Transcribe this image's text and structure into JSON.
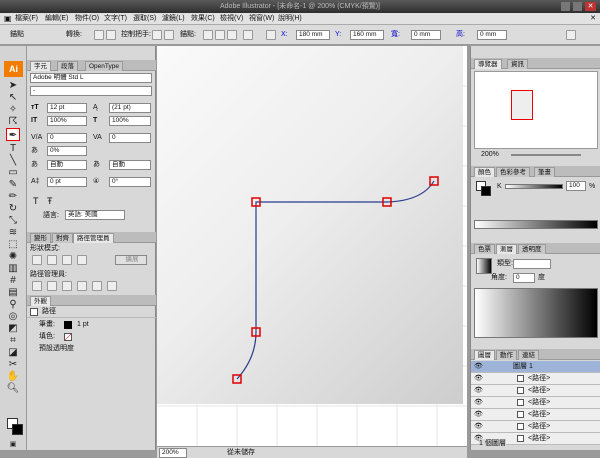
{
  "window": {
    "title": "Adobe Illustrator - [未命名-1 @ 200% (CMYK/預覽)]",
    "ai_logo": "Ai"
  },
  "menu": [
    "檔案(F)",
    "編輯(E)",
    "物件(O)",
    "文字(T)",
    "選取(S)",
    "濾鏡(L)",
    "效果(C)",
    "檢視(V)",
    "視窗(W)",
    "說明(H)"
  ],
  "control": {
    "label_anchor": "錨點",
    "label_convert": "轉換:",
    "label_handles": "控制把手:",
    "label_anchors": "錨點:",
    "x_label": "X:",
    "x": "180 mm",
    "y_label": "Y:",
    "y": "160 mm",
    "w_label": "寬:",
    "w": "0 mm",
    "h_label": "高:",
    "h": "0 mm"
  },
  "character": {
    "tabs": [
      "字元",
      "段落",
      "OpenType"
    ],
    "font": "Adobe 明體 Std L",
    "style": "-",
    "size": "12 pt",
    "leading": "(21 pt)",
    "vscale": "100%",
    "hscale": "100%",
    "kerning": "0",
    "tracking": "0",
    "tsume": "0%",
    "aki_left": "自動",
    "aki_right": "自動",
    "baseline": "0 pt",
    "rotation": "0°",
    "language_label": "語言:",
    "language": "英語: 美國"
  },
  "pathfinder": {
    "tabs": [
      "變形",
      "對齊",
      "路徑管理員"
    ],
    "shape_modes": "形狀模式:",
    "expand": "擴展",
    "pathfinders": "路徑管理員:"
  },
  "appearance": {
    "tab": "外觀",
    "item": "路徑",
    "stroke_label": "筆畫:",
    "stroke_value": "1 pt",
    "fill_label": "填色:",
    "opacity": "預設透明度"
  },
  "navigator": {
    "tabs": [
      "導覽器",
      "資訊"
    ],
    "zoom": "200%"
  },
  "color": {
    "tabs": [
      "顏色",
      "色彩參考",
      "筆畫"
    ],
    "k_label": "K",
    "k_value": "100",
    "unit": "%"
  },
  "gradient": {
    "tabs": [
      "色票",
      "漸層",
      "透明度"
    ],
    "type_label": "類型:",
    "angle_label": "角度:",
    "angle_value": "0",
    "deg": "度"
  },
  "layers": {
    "tabs": [
      "圖層",
      "動作",
      "連結"
    ],
    "rows": [
      "圖層 1",
      "<路徑>",
      "<路徑>",
      "<路徑>",
      "<路徑>",
      "<路徑>",
      "<路徑>"
    ],
    "count": "1 個圖層"
  },
  "status": {
    "zoom": "200%",
    "text": "從未儲存"
  },
  "colors": {
    "path": "#2a3c8c",
    "anchor": "#e00000",
    "tab_bg": "#c8c8c8"
  }
}
